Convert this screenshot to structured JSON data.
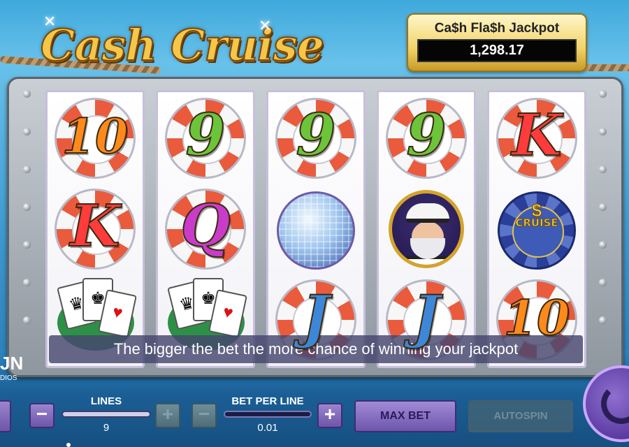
{
  "game": {
    "title": "Cash Cruise"
  },
  "jackpot": {
    "title": "Ca$h Fla$h Jackpot",
    "amount": "1,298.17"
  },
  "reels": [
    [
      "10",
      "K",
      "cards"
    ],
    [
      "9",
      "Q",
      "cards"
    ],
    [
      "9",
      "disco-ball",
      "J"
    ],
    [
      "9",
      "captain",
      "J"
    ],
    [
      "K",
      "cruise-chip",
      "10"
    ]
  ],
  "symbols": {
    "chip_label": "CRUISE",
    "chip_dollar": "$"
  },
  "message": "The bigger the bet the more chance of winning  your jackpot",
  "studio": {
    "mark": "JN",
    "sub": "DIOS"
  },
  "controls": {
    "lines_label": "LINES",
    "lines_value": "9",
    "bet_label": "BET PER LINE",
    "bet_value": "0.01",
    "minus": "−",
    "plus": "+",
    "max_bet": "MAX BET",
    "autospin": "AUTOSPIN"
  },
  "colors": {
    "accent": "#6e55a9",
    "jackpot_gold": "#f2d36a",
    "sky": "#3fa9dc"
  }
}
